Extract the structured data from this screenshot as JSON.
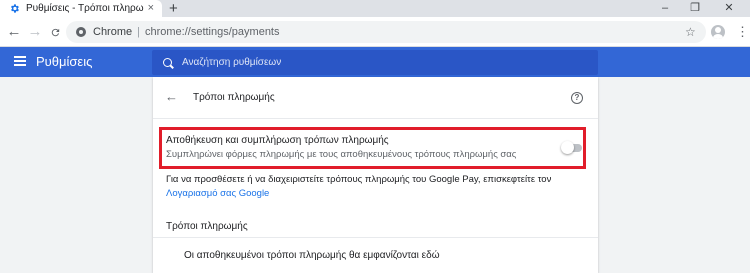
{
  "tab": {
    "title": "Ρυθμίσεις - Τρόποι πληρωμής",
    "close": "×",
    "new_tab": "+",
    "icon": "settings-gear-icon"
  },
  "window_controls": {
    "minimize": "–",
    "maximize": "❐",
    "close": "✕"
  },
  "toolbar": {
    "back": "←",
    "forward": "→",
    "reload": "C",
    "chip": "Chrome",
    "separator": "|",
    "url": "chrome://settings/payments",
    "star": "☆",
    "menu": "⋮"
  },
  "header": {
    "title": "Ρυθμίσεις",
    "search_placeholder": "Αναζήτηση ρυθμίσεων"
  },
  "page": {
    "back": "←",
    "title": "Τρόποι πληρωμής",
    "help": "?",
    "toggle_title": "Αποθήκευση και συμπλήρωση τρόπων πληρωμής",
    "toggle_desc": "Συμπληρώνει φόρμες πληρωμής με τους αποθηκευμένους τρόπους πληρωμής σας",
    "toggle_on": false,
    "info_prefix": "Για να προσθέσετε ή να διαχειριστείτε τρόπους πληρωμής του Google Pay, επισκεφτείτε τον ",
    "info_link": "Λογαριασμό σας Google",
    "section_title": "Τρόποι πληρωμής",
    "empty_message": "Οι αποθηκευμένοι τρόποι πληρωμής θα εμφανίζονται εδώ"
  },
  "colors": {
    "header": "#3367d6",
    "highlight": "#e11d2a",
    "link": "#1a73e8"
  }
}
